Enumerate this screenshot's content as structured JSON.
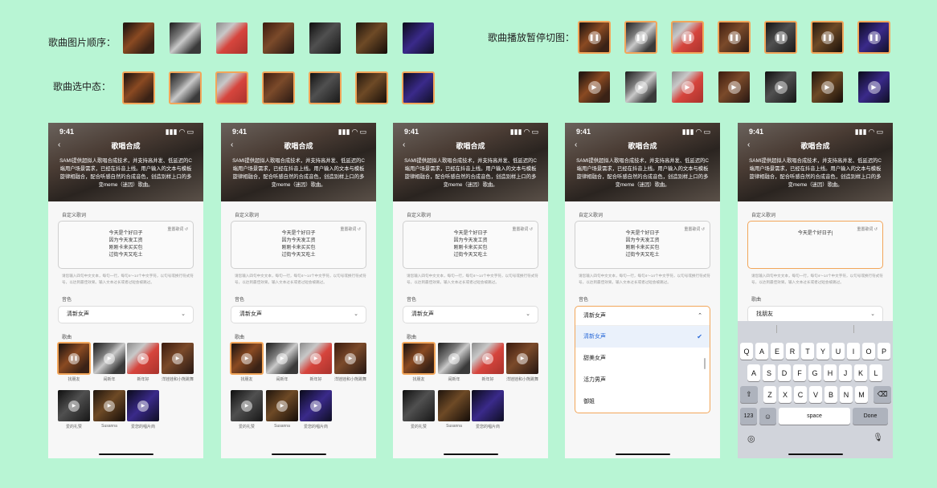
{
  "labels": {
    "order": "歌曲图片顺序：",
    "selected_state": "歌曲选中态：",
    "play_pause": "歌曲播放暂停切图："
  },
  "thumb_colors": [
    "c1",
    "c2",
    "c3",
    "c4",
    "c5",
    "c6",
    "c7"
  ],
  "icons": {
    "pause": "❚❚",
    "play": "▶"
  },
  "phone": {
    "time": "9:41",
    "signal": "▮▮▮ ◠ ▭",
    "title": "歌唱合成",
    "back": "‹",
    "description": "SAMI提供超拟人歌唱合成技术，并支持高并发、低延迟的C端用户场景需求，已经在抖音上线。用户输入的文本与模板旋律相融合，配合听感自然的合成音色，创造别样上口的多变meme（迷因）歌曲。",
    "lyrics_label": "自定义歌词",
    "reset": "重置歌词 ↺",
    "lyrics": [
      "今天是个好日子",
      "因为今天发工资",
      "刚刚卡来买买包",
      "过街今天又吃土"
    ],
    "lyrics_typing": "今天是个好日子",
    "hint": "请您输入四句中文文本，每句一行，每句4～14个中文字符，以句号或换行符式符号，以达到最佳效果。输入文本过长或者过短会被跳过。",
    "timbre_label": "音色",
    "timbre_value": "清新女声",
    "song_label": "歌曲",
    "song_label_alt": "歌曲",
    "song_value": "找朋友",
    "songs": [
      "找朋友",
      "闹新年",
      "新年好",
      "洋娃娃和小熊跳舞",
      "爱的礼赞",
      "Susanna",
      "爱您的唱片商"
    ],
    "chevron_down": "⌄",
    "chevron_up": "⌃"
  },
  "dropdown": {
    "header": "清新女声",
    "options": [
      "清新女声",
      "甜美女声",
      "活力男声",
      "御姐"
    ],
    "check": "✔"
  },
  "keyboard": {
    "row1": [
      "Q",
      "A",
      "E",
      "R",
      "T",
      "Y",
      "U",
      "I",
      "O",
      "P"
    ],
    "row2": [
      "A",
      "S",
      "D",
      "F",
      "G",
      "H",
      "J",
      "K",
      "L"
    ],
    "row3": [
      "Z",
      "X",
      "C",
      "V",
      "B",
      "N",
      "M"
    ],
    "shift": "⇧",
    "delete": "⌫",
    "num": "123",
    "emoji": "☺",
    "space": "space",
    "done": "Done",
    "globe": "◎",
    "mic": "🎙"
  }
}
